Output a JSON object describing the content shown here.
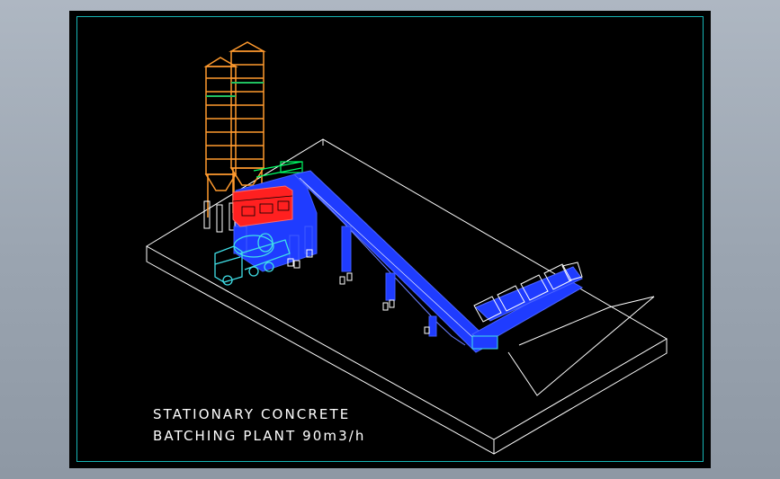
{
  "drawing": {
    "title_line_1": "STATIONARY CONCRETE",
    "title_line_2": "BATCHING PLANT 90m3/h"
  },
  "colors": {
    "background": "#000000",
    "frame": "#17b4b4",
    "outline": "#ffffff",
    "silo": "#ff9a2e",
    "silo_band": "#20c060",
    "control_cabin": "#ff2020",
    "steel_structure": "#1f3cff",
    "truck": "#40e0e8",
    "feeder": "#00ff66"
  },
  "icons": [
    "cement-silo-icon",
    "control-cabin-icon",
    "belt-conveyor-icon",
    "aggregate-hopper-icon",
    "mixer-truck-icon"
  ]
}
